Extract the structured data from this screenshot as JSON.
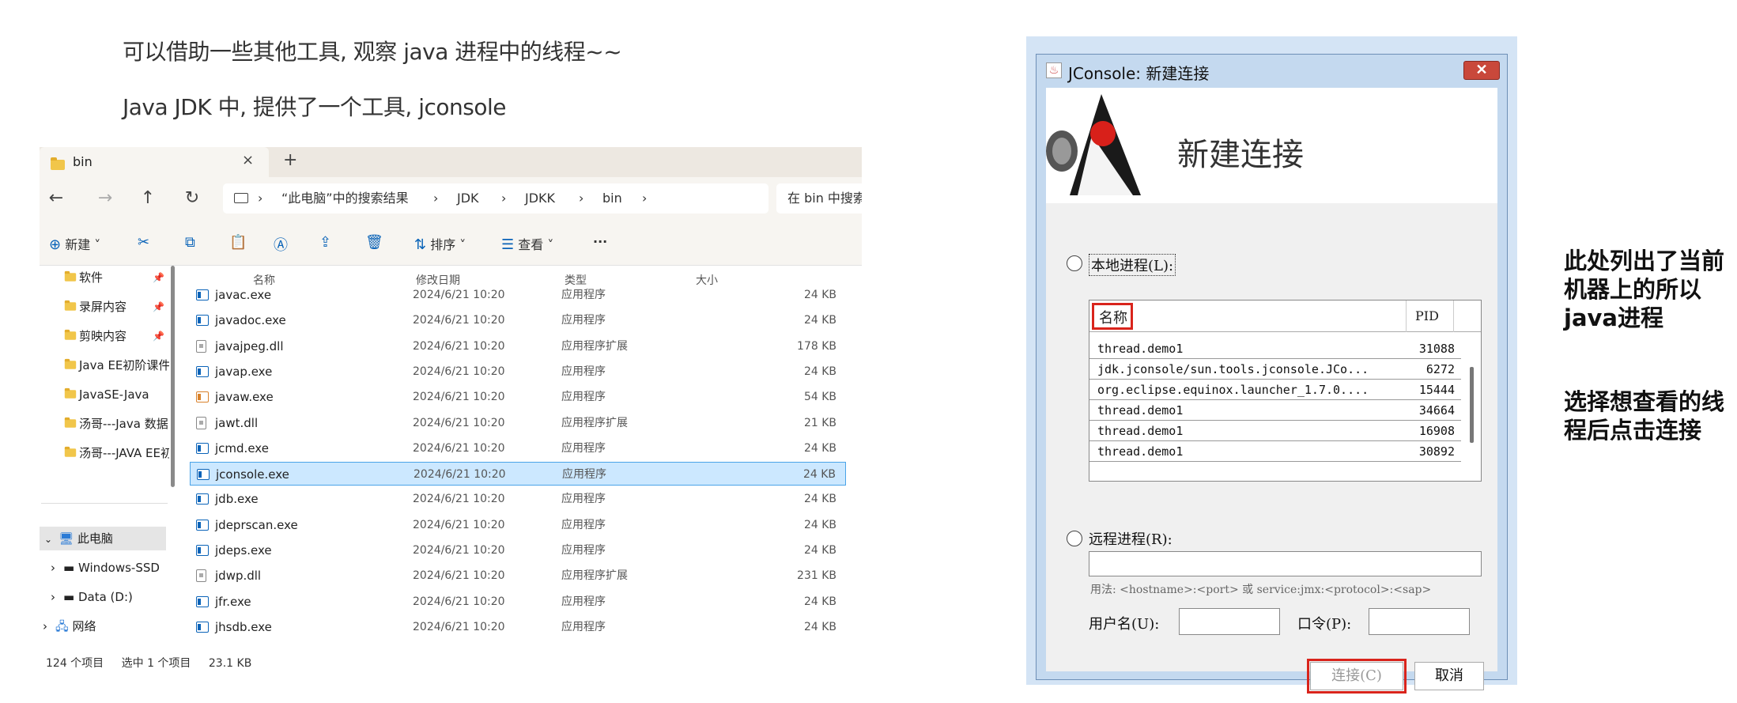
{
  "captions": {
    "line1": "可以借助一些其他工具, 观察 java 进程中的线程~~",
    "line2": "Java JDK 中, 提供了一个工具, jconsole"
  },
  "explorer": {
    "tab_title": "bin",
    "tab_close": "×",
    "tab_add": "+",
    "nav": {
      "back": "←",
      "forward": "→",
      "up": "↑",
      "refresh": "↻"
    },
    "breadcrumb": [
      "“此电脑”中的搜索结果",
      "JDK",
      "JDKK",
      "bin"
    ],
    "search_placeholder": "在 bin 中搜索",
    "toolbar": {
      "new": "新建",
      "sort": "排序",
      "view": "查看",
      "more": "···"
    },
    "sidebar": {
      "pinned": [
        "软件",
        "录屏内容",
        "剪映内容",
        "Java EE初阶课件",
        "JavaSE-Java",
        "汤哥---Java 数据",
        "汤哥---JAVA EE初"
      ],
      "this_pc": "此电脑",
      "drives": [
        "Windows-SSD",
        "Data (D:)"
      ],
      "network": "网络"
    },
    "columns": {
      "name": "名称",
      "date": "修改日期",
      "type": "类型",
      "size": "大小"
    },
    "files": [
      {
        "name": "javac.exe",
        "date": "2024/6/21 10:20",
        "type": "应用程序",
        "size": "24 KB",
        "icon": "exe"
      },
      {
        "name": "javadoc.exe",
        "date": "2024/6/21 10:20",
        "type": "应用程序",
        "size": "24 KB",
        "icon": "exe"
      },
      {
        "name": "javajpeg.dll",
        "date": "2024/6/21 10:20",
        "type": "应用程序扩展",
        "size": "178 KB",
        "icon": "dll"
      },
      {
        "name": "javap.exe",
        "date": "2024/6/21 10:20",
        "type": "应用程序",
        "size": "24 KB",
        "icon": "exe"
      },
      {
        "name": "javaw.exe",
        "date": "2024/6/21 10:20",
        "type": "应用程序",
        "size": "54 KB",
        "icon": "java"
      },
      {
        "name": "jawt.dll",
        "date": "2024/6/21 10:20",
        "type": "应用程序扩展",
        "size": "21 KB",
        "icon": "dll"
      },
      {
        "name": "jcmd.exe",
        "date": "2024/6/21 10:20",
        "type": "应用程序",
        "size": "24 KB",
        "icon": "exe"
      },
      {
        "name": "jconsole.exe",
        "date": "2024/6/21 10:20",
        "type": "应用程序",
        "size": "24 KB",
        "icon": "exe",
        "selected": true
      },
      {
        "name": "jdb.exe",
        "date": "2024/6/21 10:20",
        "type": "应用程序",
        "size": "24 KB",
        "icon": "exe"
      },
      {
        "name": "jdeprscan.exe",
        "date": "2024/6/21 10:20",
        "type": "应用程序",
        "size": "24 KB",
        "icon": "exe"
      },
      {
        "name": "jdeps.exe",
        "date": "2024/6/21 10:20",
        "type": "应用程序",
        "size": "24 KB",
        "icon": "exe"
      },
      {
        "name": "jdwp.dll",
        "date": "2024/6/21 10:20",
        "type": "应用程序扩展",
        "size": "231 KB",
        "icon": "dll"
      },
      {
        "name": "jfr.exe",
        "date": "2024/6/21 10:20",
        "type": "应用程序",
        "size": "24 KB",
        "icon": "exe"
      },
      {
        "name": "jhsdb.exe",
        "date": "2024/6/21 10:20",
        "type": "应用程序",
        "size": "24 KB",
        "icon": "exe"
      }
    ],
    "status": {
      "count": "124 个项目",
      "selected": "选中 1 个项目",
      "size": "23.1 KB"
    }
  },
  "jconsole": {
    "window_title": "JConsole: 新建连接",
    "close": "✕",
    "heading": "新建连接",
    "local_label": "本地进程(L):",
    "col_name": "名称",
    "col_pid": "PID",
    "processes": [
      {
        "name": "thread.demo1",
        "pid": "31088"
      },
      {
        "name": "jdk.jconsole/sun.tools.jconsole.JCo...",
        "pid": "6272"
      },
      {
        "name": "org.eclipse.equinox.launcher_1.7.0....",
        "pid": "15444"
      },
      {
        "name": "thread.demo1",
        "pid": "34664"
      },
      {
        "name": "thread.demo1",
        "pid": "16908"
      },
      {
        "name": "thread.demo1",
        "pid": "30892"
      }
    ],
    "remote_label": "远程进程(R):",
    "remote_hint": "用法: <hostname>:<port> 或 service:jmx:<protocol>:<sap>",
    "username_label": "用户名(U):",
    "password_label": "口令(P):",
    "connect_button": "连接(C)",
    "cancel_button": "取消"
  },
  "notes": {
    "note1": "此处列出了当前机器上的所以java进程",
    "note2": "选择想查看的线程后点击连接"
  },
  "colors": {
    "highlight_red": "#d9241c",
    "selection_blue": "#cce8ff"
  }
}
